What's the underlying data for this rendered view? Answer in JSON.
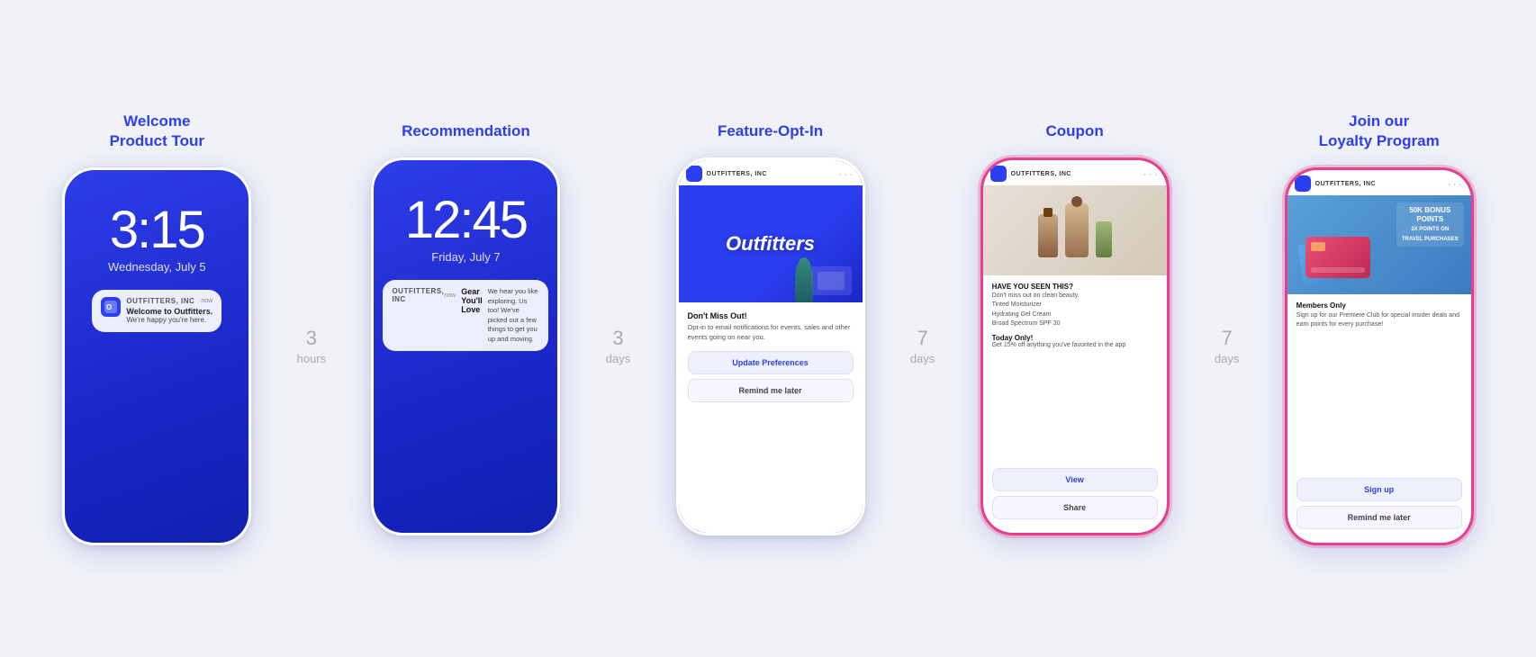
{
  "phones": [
    {
      "id": "welcome",
      "title": "Welcome\nProduct Tour",
      "type": "lockscreen",
      "time": "3:15",
      "date": "Wednesday, July 5",
      "notification": {
        "app": "OUTFITTERS, INC",
        "time": "now",
        "title": "Welcome to Outfitters.",
        "body": "We're happy you're here."
      }
    },
    {
      "id": "recommendation",
      "title": "Recommendation",
      "type": "lockscreen",
      "time": "12:45",
      "date": "Friday, July 7",
      "notification": {
        "app": "OUTFITTERS, INC",
        "time": "now",
        "title": "Gear You'll Love",
        "body": "We hear you like exploring. Us too! We've picked out a few things to get you up and moving."
      }
    },
    {
      "id": "feature-optin",
      "title": "Feature-Opt-In",
      "type": "appscreen",
      "appName": "OUTFITTERS, INC",
      "heroLogo": "Outfitters",
      "sectionTitle": "Don't Miss Out!",
      "sectionBody": "Opt-in to email notifications for events, sales and other events going on near you.",
      "buttons": [
        {
          "label": "Update Preferences",
          "style": "primary"
        },
        {
          "label": "Remind me later",
          "style": "secondary"
        }
      ]
    },
    {
      "id": "coupon",
      "title": "Coupon",
      "type": "coupon",
      "appName": "OUTFITTERS, INC",
      "couponTitle": "HAVE YOU SEEN THIS?",
      "couponSubtitle": "Don't miss out on clean beauty.",
      "items": [
        "Tinted Moisturizer",
        "Hydrating Gel Cream",
        "Broad Spectrum SPF 30"
      ],
      "promoTitle": "Today Only!",
      "promoBody": "Get 15% off anything you've favorited in the app",
      "buttons": [
        {
          "label": "View",
          "style": "primary"
        },
        {
          "label": "Share",
          "style": "secondary"
        }
      ],
      "highlighted": true
    },
    {
      "id": "loyalty",
      "title": "Join our\nLoyalty Program",
      "type": "loyalty",
      "appName": "OUTFITTERS, INC",
      "bonusText": "50K BONUS\nPOINTS\n3X POINTS ON\nTRAVEL PURCHASES",
      "loyaltyTitle": "Members Only",
      "loyaltyBody": "Sign up for our Premiere Club for special insider deals and earn points for every purchase!",
      "buttons": [
        {
          "label": "Sign up",
          "style": "primary"
        },
        {
          "label": "Remind me later",
          "style": "secondary"
        }
      ],
      "highlighted": true
    }
  ],
  "connectors": [
    {
      "num": "3",
      "label": "hours"
    },
    {
      "num": "3",
      "label": "days"
    },
    {
      "num": "7",
      "label": "days"
    },
    {
      "num": "7",
      "label": "days"
    }
  ]
}
